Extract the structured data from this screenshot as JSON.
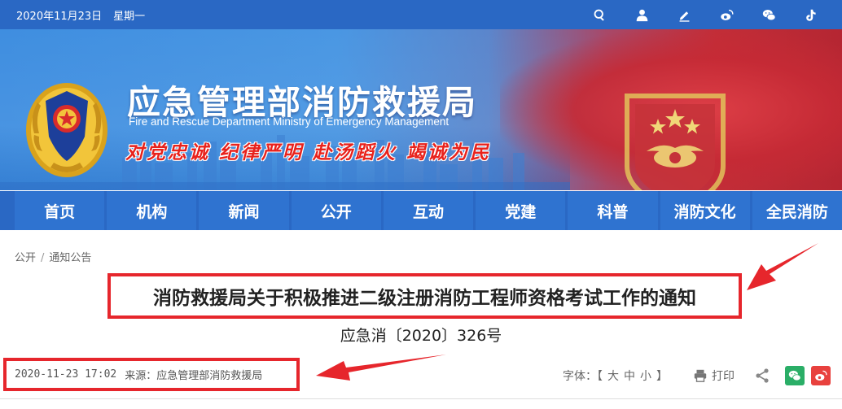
{
  "topbar": {
    "date": "2020年11月23日",
    "weekday": "星期一",
    "icons": [
      "search-icon",
      "user-icon",
      "edit-icon",
      "weibo-icon",
      "wechat-icon",
      "tiktok-icon"
    ]
  },
  "banner": {
    "title_cn": "应急管理部消防救援局",
    "title_en": "Fire and Rescue Department Ministry of Emergency Management",
    "slogan": "对党忠诚 纪律严明 赴汤蹈火 竭诚为民"
  },
  "nav": {
    "items": [
      "首页",
      "机构",
      "新闻",
      "公开",
      "互动",
      "党建",
      "科普",
      "消防文化",
      "全民消防"
    ]
  },
  "breadcrumb": {
    "level1": "公开",
    "separator": "/",
    "level2": "通知公告"
  },
  "article": {
    "title": "消防救援局关于积极推进二级注册消防工程师资格考试工作的通知",
    "doc_number": "应急消〔2020〕326号",
    "publish_time": "2020-11-23 17:02",
    "source": "来源：应急管理部消防救援局"
  },
  "tools": {
    "font_label": "字体：【",
    "font_large": "大",
    "font_medium": "中",
    "font_small": "小",
    "font_close": "】",
    "print_label": "打印"
  },
  "colors": {
    "primary_blue": "#2a68c4",
    "highlight_red": "#e6262c",
    "wechat_green": "#2aae67",
    "weibo_red": "#e8413e"
  }
}
